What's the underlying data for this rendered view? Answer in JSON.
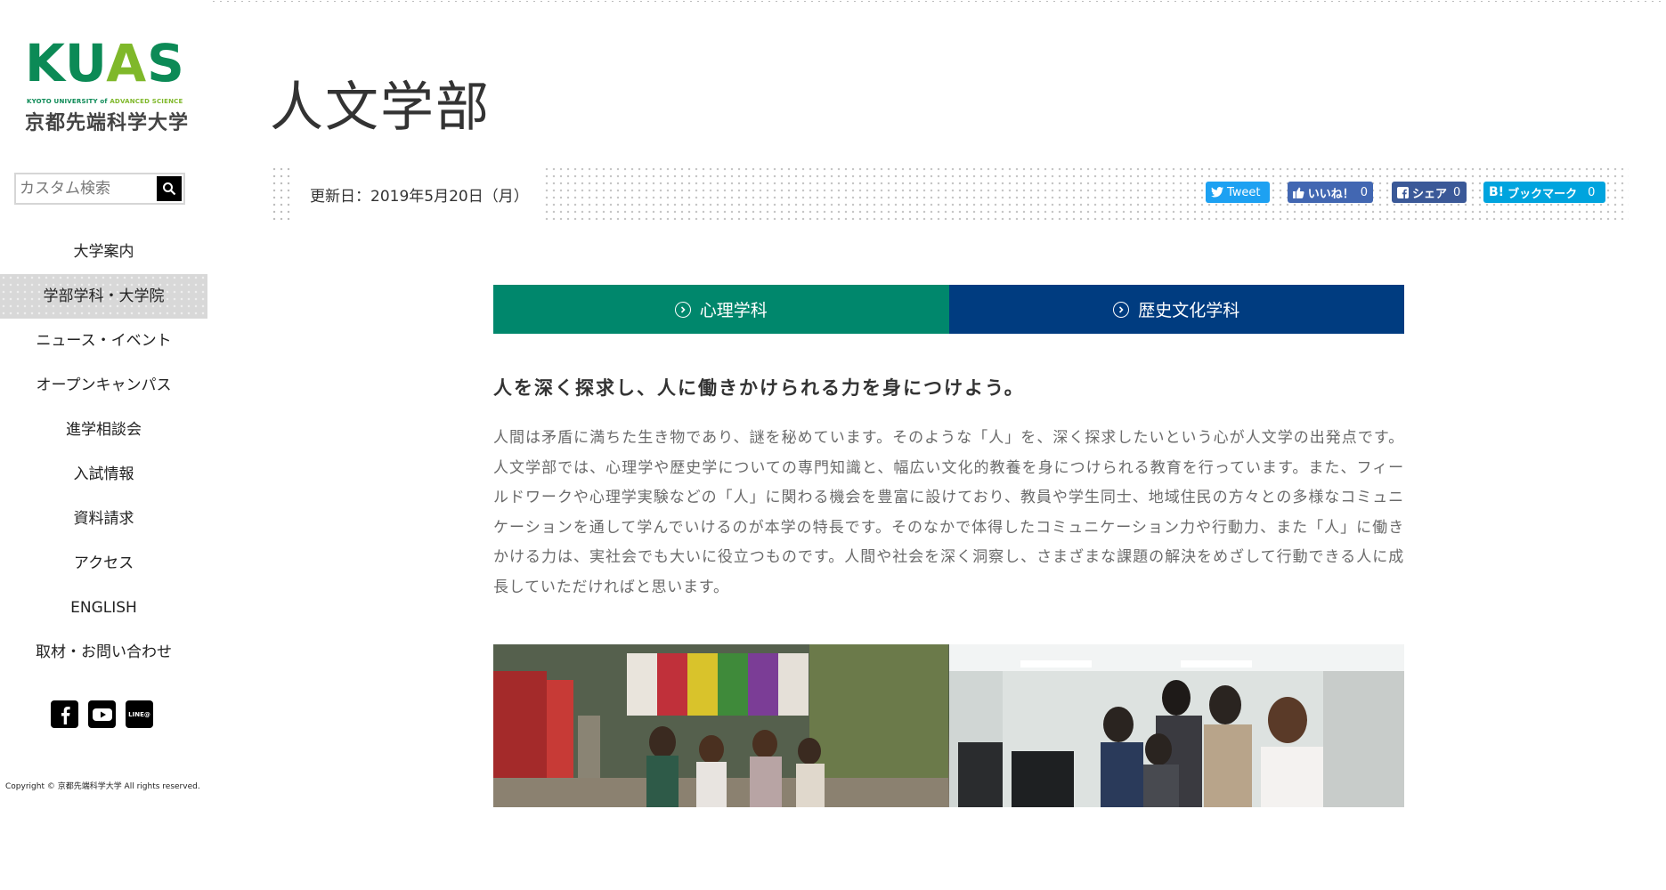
{
  "logo": {
    "mark_left": "KU",
    "mark_a": "A",
    "mark_right": "S",
    "sub_left": "KYOTO UNIVERSITY of ",
    "sub_adv": "ADVANCED SCIENCE",
    "japanese": "京都先端科学大学"
  },
  "search": {
    "placeholder": "カスタム検索"
  },
  "nav": {
    "items": [
      {
        "label": "大学案内"
      },
      {
        "label": "学部学科・大学院"
      },
      {
        "label": "ニュース・イベント"
      },
      {
        "label": "オープンキャンパス"
      },
      {
        "label": "進学相談会"
      },
      {
        "label": "入試情報"
      },
      {
        "label": "資料請求"
      },
      {
        "label": "アクセス"
      },
      {
        "label": "ENGLISH"
      },
      {
        "label": "取材・お問い合わせ"
      }
    ]
  },
  "social": {
    "icons": [
      "facebook-icon",
      "youtube-icon",
      "line-icon"
    ],
    "line_label": "LINE@"
  },
  "copyright": "Copyright © 京都先端科学大学 All rights reserved.",
  "page": {
    "title": "人文学部",
    "updated": "更新日：2019年5月20日（月）"
  },
  "share": {
    "tweet": "Tweet",
    "like": "いいね！",
    "like_count": "0",
    "fb_share": "シェア",
    "fb_share_count": "0",
    "hatena": "ブックマーク",
    "hatena_count": "0"
  },
  "tabs": [
    {
      "label": "心理学科",
      "color": "#00876c"
    },
    {
      "label": "歴史文化学科",
      "color": "#003c80"
    }
  ],
  "content": {
    "lead": "人を深く探求し、人に働きかけられる力を身につけよう。",
    "body": "人間は矛盾に満ちた生き物であり、謎を秘めています。そのような「人」を、深く探求したいという心が人文学の出発点です。人文学部では、心理学や歴史学についての専門知識と、幅広い文化的教養を身につけられる教育を行っています。また、フィールドワークや心理学実験などの「人」に関わる機会を豊富に設けており、教員や学生同士、地域住民の方々との多様なコミュニケーションを通して学んでいけるのが本学の特長です。そのなかで体得したコミュニケーション力や行動力、また「人」に働きかける力は、実社会でも大いに役立つものです。人間や社会を深く洞察し、さまざまな課題の解決をめざして行動できる人に成長していただければと思います。"
  },
  "colors": {
    "accent_green": "#00876c",
    "accent_navy": "#003c80",
    "brand_green": "#0c8a56",
    "brand_lime": "#7fb82a"
  }
}
